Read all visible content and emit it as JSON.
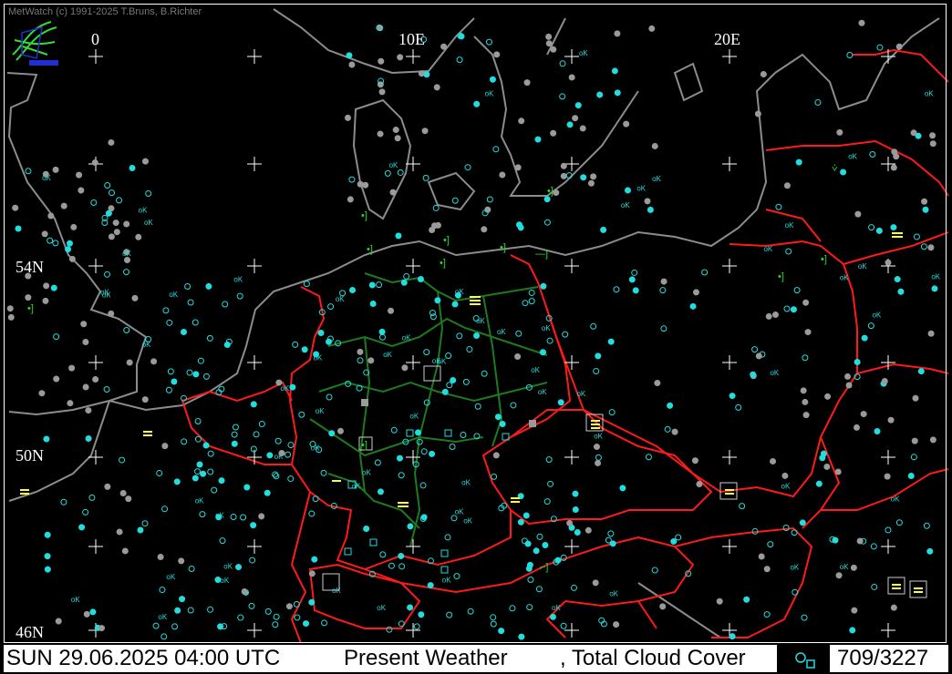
{
  "credit": "MetWatch  (c) 1991-2025 T.Bruns, B.Richter",
  "longitude_labels": [
    "0",
    "10E",
    "20E"
  ],
  "latitude_labels": [
    "54N",
    "50N",
    "46N"
  ],
  "footer": {
    "datetime": "SUN 29.06.2025 04:00 UTC",
    "product": "Present Weather",
    "parameter": ", Total Cloud Cover",
    "count": "709/3227"
  },
  "station_text": "oK",
  "colors": {
    "background": "#000000",
    "coastline": "#8c8c8c",
    "border": "#ff1a1a",
    "state_border": "#1e7a1e",
    "station_cyan": "#22dddd",
    "station_gray": "#9a9a9a",
    "weather_yellow": "#ffff33",
    "weather_green": "#22dd22",
    "grid": "#ffffff"
  },
  "icons": [
    "metwatch-logo-icon",
    "grid-cross-icon",
    "station-circle-icon",
    "fog-symbol-icon",
    "drizzle-symbol-icon"
  ]
}
